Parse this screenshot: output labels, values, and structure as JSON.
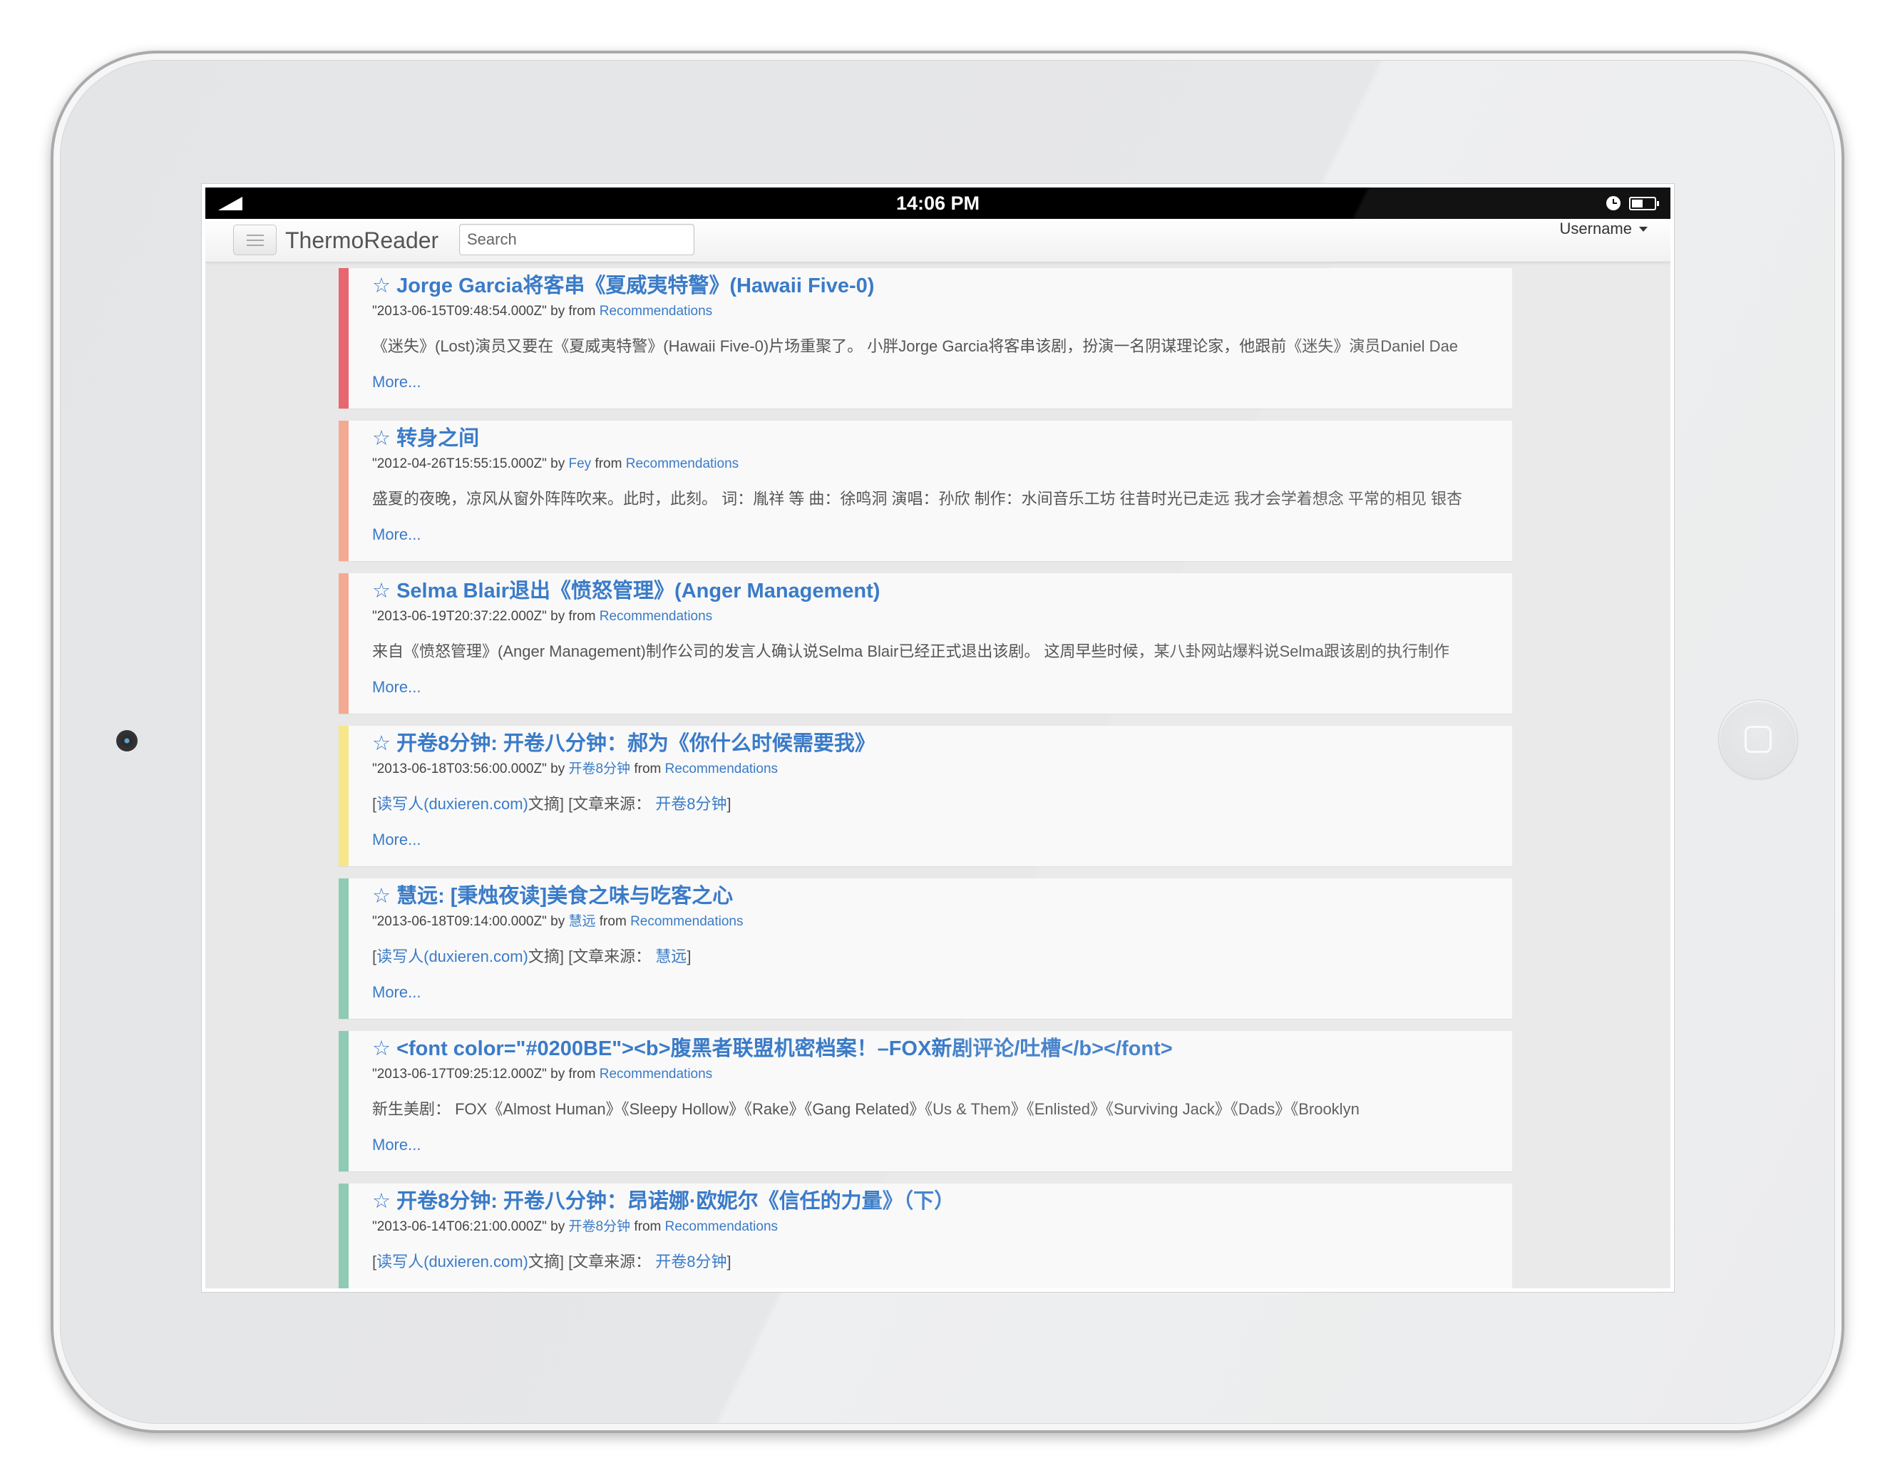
{
  "status_bar": {
    "time": "14:06 PM",
    "signal_icon": "signal-icon",
    "clock_icon": "clock-icon",
    "battery_icon": "battery-icon",
    "battery_level": 0.5
  },
  "navbar": {
    "menu_icon": "hamburger-icon",
    "brand": "ThermoReader",
    "search": {
      "placeholder": "Search"
    },
    "user_menu": {
      "label": "Username",
      "icon": "caret-down-icon"
    }
  },
  "colors": {
    "link": "#3a7bc8",
    "content_bg": "#e8e8e8",
    "card_bg": "#f9f9f9",
    "status_bar_bg": "#000000"
  },
  "feed": {
    "items": [
      {
        "accent_color": "#e7666f",
        "star": "☆",
        "title": "Jorge Garcia将客串《夏威夷特警》(Hawaii Five-0)",
        "date": "\"2013-06-15T09:48:54.000Z\"",
        "by_label": "by",
        "author": "",
        "from_label": "from",
        "source": "Recommendations",
        "excerpt": [
          {
            "text": "《迷失》(Lost)演员又要在《夏威夷特警》(Hawaii Five-0)片场重聚了。 小胖Jorge Garcia将客串该剧，扮演一名阴谋理论家，他跟前《迷失》演员Daniel Dae",
            "link": false
          }
        ],
        "more": "More..."
      },
      {
        "accent_color": "#f4aa92",
        "star": "☆",
        "title": "转身之间",
        "date": "\"2012-04-26T15:55:15.000Z\"",
        "by_label": "by",
        "author": "Fey",
        "from_label": "from",
        "source": "Recommendations",
        "excerpt": [
          {
            "text": "盛夏的夜晚，凉风从窗外阵阵吹来。此时，此刻。 词：胤祥 等 曲：徐鸣洞 演唱：孙欣 制作：水间音乐工坊 往昔时光已走远 我才会学着想念 平常的相见 银杏",
            "link": false
          }
        ],
        "more": "More..."
      },
      {
        "accent_color": "#f4aa92",
        "star": "☆",
        "title": "Selma Blair退出《愤怒管理》(Anger Management)",
        "date": "\"2013-06-19T20:37:22.000Z\"",
        "by_label": "by",
        "author": "",
        "from_label": "from",
        "source": "Recommendations",
        "excerpt": [
          {
            "text": "来自《愤怒管理》(Anger Management)制作公司的发言人确认说Selma Blair已经正式退出该剧。 这周早些时候，某八卦网站爆料说Selma跟该剧的执行制作",
            "link": false
          }
        ],
        "more": "More..."
      },
      {
        "accent_color": "#f8e68a",
        "star": "☆",
        "title": "开卷8分钟: 开卷八分钟：郝为《你什么时候需要我》",
        "date": "\"2013-06-18T03:56:00.000Z\"",
        "by_label": "by",
        "author": "开卷8分钟",
        "from_label": "from",
        "source": "Recommendations",
        "excerpt": [
          {
            "text": "[",
            "link": false
          },
          {
            "text": "读写人(duxieren.com)",
            "link": true
          },
          {
            "text": "文摘] [文章来源： ",
            "link": false
          },
          {
            "text": "开卷8分钟",
            "link": true
          },
          {
            "text": "]",
            "link": false
          }
        ],
        "more": "More..."
      },
      {
        "accent_color": "#8fcab4",
        "star": "☆",
        "title": "慧远: [秉烛夜读]美食之味与吃客之心",
        "date": "\"2013-06-18T09:14:00.000Z\"",
        "by_label": "by",
        "author": "慧远",
        "from_label": "from",
        "source": "Recommendations",
        "excerpt": [
          {
            "text": "[",
            "link": false
          },
          {
            "text": "读写人(duxieren.com)",
            "link": true
          },
          {
            "text": "文摘] [文章来源： ",
            "link": false
          },
          {
            "text": "慧远",
            "link": true
          },
          {
            "text": "]",
            "link": false
          }
        ],
        "more": "More..."
      },
      {
        "accent_color": "#8fcab4",
        "star": "☆",
        "title": "<font color=\"#0200BE\"><b>腹黑者联盟机密档案！–FOX新剧评论/吐槽</b></font>",
        "date": "\"2013-06-17T09:25:12.000Z\"",
        "by_label": "by",
        "author": "",
        "from_label": "from",
        "source": "Recommendations",
        "excerpt": [
          {
            "text": "新生美剧： FOX《Almost Human》《Sleepy Hollow》《Rake》《Gang Related》《Us & Them》《Enlisted》《Surviving Jack》《Dads》《Brooklyn",
            "link": false
          }
        ],
        "more": "More..."
      },
      {
        "accent_color": "#8fcab4",
        "star": "☆",
        "title": "开卷8分钟: 开卷八分钟：昂诺娜·欧妮尔《信任的力量》（下）",
        "date": "\"2013-06-14T06:21:00.000Z\"",
        "by_label": "by",
        "author": "开卷8分钟",
        "from_label": "from",
        "source": "Recommendations",
        "excerpt": [
          {
            "text": "[",
            "link": false
          },
          {
            "text": "读写人(duxieren.com)",
            "link": true
          },
          {
            "text": "文摘] [文章来源： ",
            "link": false
          },
          {
            "text": "开卷8分钟",
            "link": true
          },
          {
            "text": "]",
            "link": false
          }
        ]
      }
    ]
  }
}
